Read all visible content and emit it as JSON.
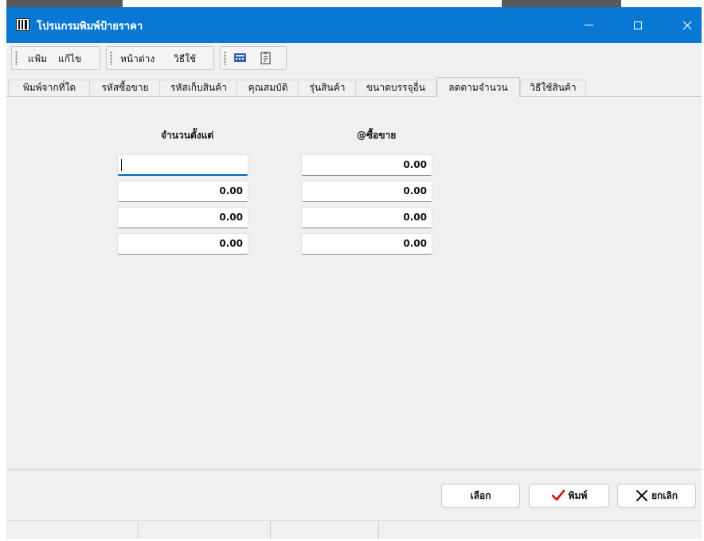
{
  "window": {
    "title": "โปรแกรมพิมพ์ป้ายราคา"
  },
  "toolbar": {
    "menu1": [
      "แฟ้ม",
      "แก้ไข"
    ],
    "menu2": [
      "หน้าต่าง",
      "วิธีใช้"
    ],
    "icons": [
      "calculator-icon",
      "calendar-icon"
    ]
  },
  "tabs": [
    {
      "label": "พิมพ์จากที่ใด"
    },
    {
      "label": "รหัสซื้อขาย"
    },
    {
      "label": "รหัสเก็บสินค้า"
    },
    {
      "label": "คุณสมบัติ"
    },
    {
      "label": "รุ่นสินค้า"
    },
    {
      "label": "ขนาดบรรจุอื่น"
    },
    {
      "label": "ลดตามจำนวน",
      "active": true
    },
    {
      "label": "วิธีใช้สินค้า"
    }
  ],
  "columns": {
    "qty_header": "จำนวนตั้งแต่",
    "price_header": "@ซื้อขาย"
  },
  "rows": [
    {
      "qty": "",
      "price": "0.00"
    },
    {
      "qty": "0.00",
      "price": "0.00"
    },
    {
      "qty": "0.00",
      "price": "0.00"
    },
    {
      "qty": "0.00",
      "price": "0.00"
    }
  ],
  "buttons": {
    "select": "เลือก",
    "print": "พิมพ์",
    "cancel": "ยกเลิก"
  },
  "colors": {
    "titlebar": "#0878d4",
    "print_check": "#d01010",
    "focus": "#0067c0"
  }
}
